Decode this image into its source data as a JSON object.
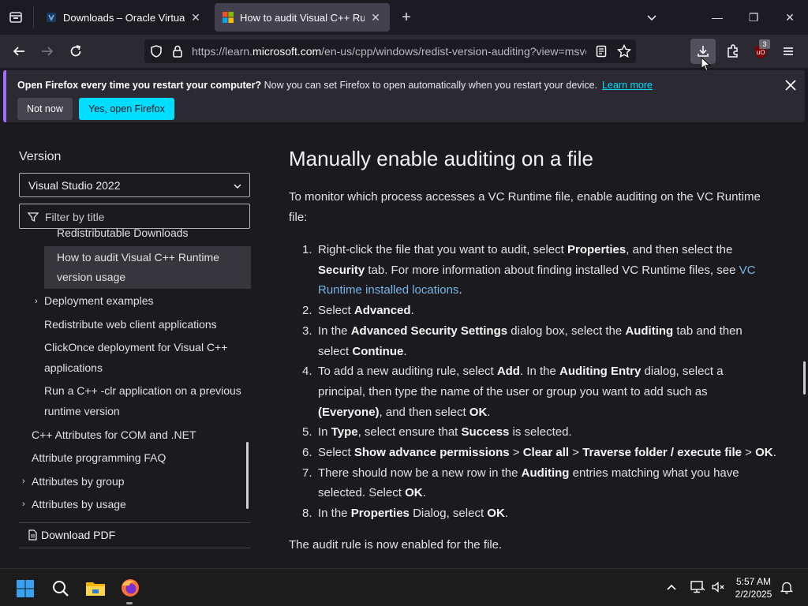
{
  "browser": {
    "tabs": [
      {
        "label": "Downloads – Oracle VirtualBox",
        "active": false
      },
      {
        "label": "How to audit Visual C++ Runtim",
        "active": true
      }
    ],
    "url_prefix": "https://learn.",
    "url_host": "microsoft.com",
    "url_rest": "/en-us/cpp/windows/redist-version-auditing?view=msvc",
    "extension_badge": "3"
  },
  "notification": {
    "bold": "Open Firefox every time you restart your computer?",
    "text": "Now you can set Firefox to open automatically when you restart your device.",
    "link": "Learn more",
    "not_now": "Not now",
    "yes": "Yes, open Firefox"
  },
  "sidebar": {
    "version_heading": "Version",
    "version_selected": "Visual Studio 2022",
    "filter_placeholder": "Filter by title",
    "toc": [
      {
        "label": "Redistributable Downloads"
      },
      {
        "label_line1": "How to audit Visual C++ Runtime",
        "label_line2": "version usage",
        "active": true
      },
      {
        "label": "Deployment examples"
      },
      {
        "label": "Redistribute web client applications"
      },
      {
        "label_line1": "ClickOnce deployment for Visual C++",
        "label_line2": "applications"
      },
      {
        "label_line1": "Run a C++ -clr application on a previous",
        "label_line2": "runtime version"
      },
      {
        "label": "C++ Attributes for COM and .NET"
      },
      {
        "label": "Attribute programming FAQ"
      },
      {
        "label": "Attributes by group"
      },
      {
        "label": "Attributes by usage"
      }
    ],
    "download_pdf": "Download PDF"
  },
  "article": {
    "heading": "Manually enable auditing on a file",
    "intro_line1": "To monitor which process accesses a VC Runtime file, enable auditing on the VC Runtime",
    "intro_line2": "file:",
    "steps": {
      "s1": {
        "a": "Right-click the file that you want to audit, select ",
        "b": "Properties",
        "c": ", and then select the",
        "d": "Security",
        "e": " tab. For more information about finding installed VC Runtime files, see ",
        "link1": "VC",
        "link2": "Runtime installed locations",
        "f": "."
      },
      "s2": {
        "a": "Select ",
        "b": "Advanced",
        "c": "."
      },
      "s3": {
        "a": "In the ",
        "b": "Advanced Security Settings",
        "c": " dialog box, select the ",
        "d": "Auditing",
        "e": " tab and then",
        "f": "select ",
        "g": "Continue",
        "h": "."
      },
      "s4": {
        "a": "To add a new auditing rule, select ",
        "b": "Add",
        "c": ". In the ",
        "d": "Auditing Entry",
        "e": " dialog, select a",
        "f": "principal, then type the name of the user or group you want to add such as",
        "g": "(Everyone)",
        "h": ", and then select ",
        "i": "OK",
        "j": "."
      },
      "s5": {
        "a": "In ",
        "b": "Type",
        "c": ", select ensure that ",
        "d": "Success",
        "e": " is selected."
      },
      "s6": {
        "a": "Select ",
        "b": "Show advance permissions",
        "c": " > ",
        "d": "Clear all",
        "e": " > ",
        "f": "Traverse folder / execute file",
        "g": " > ",
        "h": "OK",
        "i": "."
      },
      "s7": {
        "a": "There should now be a new row in the ",
        "b": "Auditing",
        "c": " entries matching what you have",
        "d": "selected. Select ",
        "e": "OK",
        "f": "."
      },
      "s8": {
        "a": "In the ",
        "b": "Properties",
        "c": " Dialog, select ",
        "d": "OK",
        "e": "."
      }
    },
    "outro": "The audit rule is now enabled for the file."
  },
  "taskbar": {
    "time": "5:57 AM",
    "date": "2/2/2025"
  },
  "colors": {
    "accent_cyan": "#00ddff",
    "link_blue": "#75b6e7",
    "purple_bar": "#a16cff"
  }
}
